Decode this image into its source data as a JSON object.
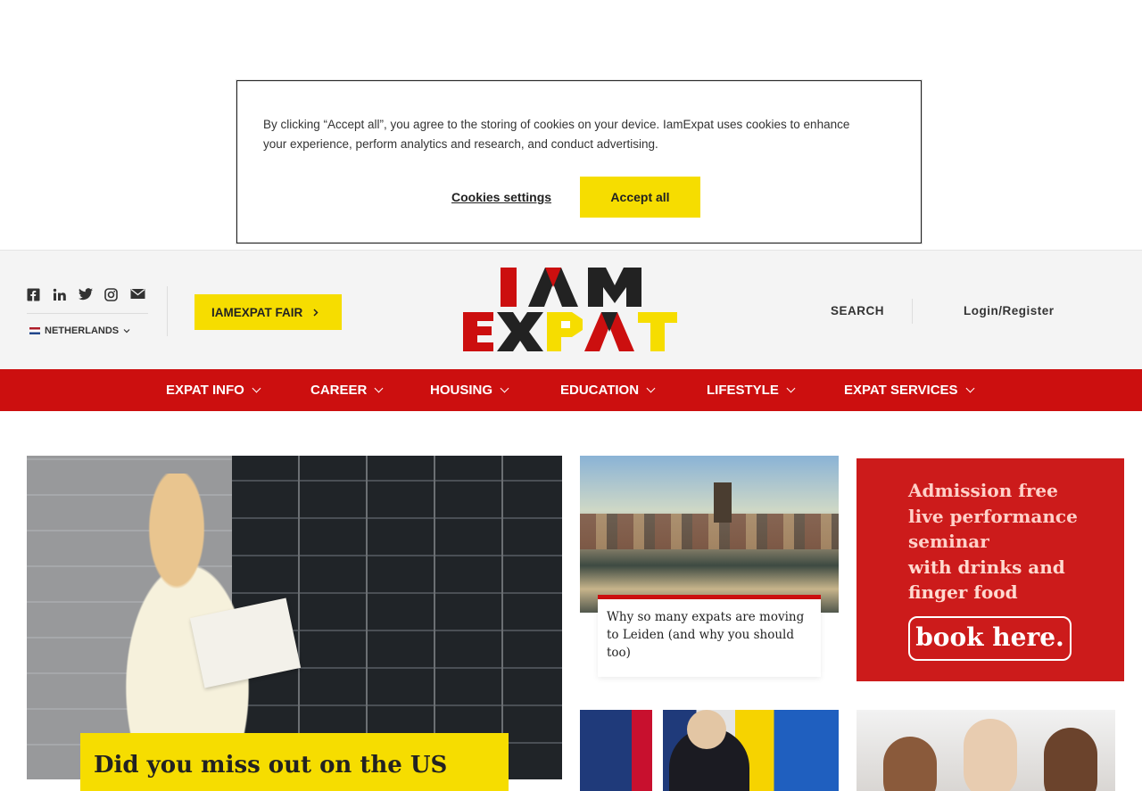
{
  "cookie_banner": {
    "text": "By clicking “Accept all”, you agree to the storing of cookies on your device. IamExpat uses cookies to enhance your experience, perform analytics and research, and conduct advertising.",
    "settings_label": "Cookies settings",
    "accept_label": "Accept all"
  },
  "header": {
    "social_icons": [
      "facebook-icon",
      "linkedin-icon",
      "twitter-icon",
      "instagram-icon",
      "mail-icon"
    ],
    "country": "NETHERLANDS",
    "fair_button": "IAMEXPAT FAIR",
    "logo_line1": "I AM",
    "logo_line2": "EXPAT",
    "search_label": "SEARCH",
    "login_label": "Login/Register",
    "colors": {
      "yellow": "#f6dd00",
      "red": "#cc0f0f"
    }
  },
  "nav": {
    "items": [
      "EXPAT INFO",
      "CAREER",
      "HOUSING",
      "EDUCATION",
      "LIFESTYLE",
      "EXPAT SERVICES"
    ]
  },
  "content": {
    "hero_title": "Did you miss out on the US",
    "card1_title": "Why so many expats are moving to Leiden (and why you should too)",
    "ad": {
      "line1": "Admission free",
      "line2": "live performance",
      "line3": "seminar",
      "line4": "with drinks and",
      "line5": "finger food",
      "button": "book here."
    }
  }
}
